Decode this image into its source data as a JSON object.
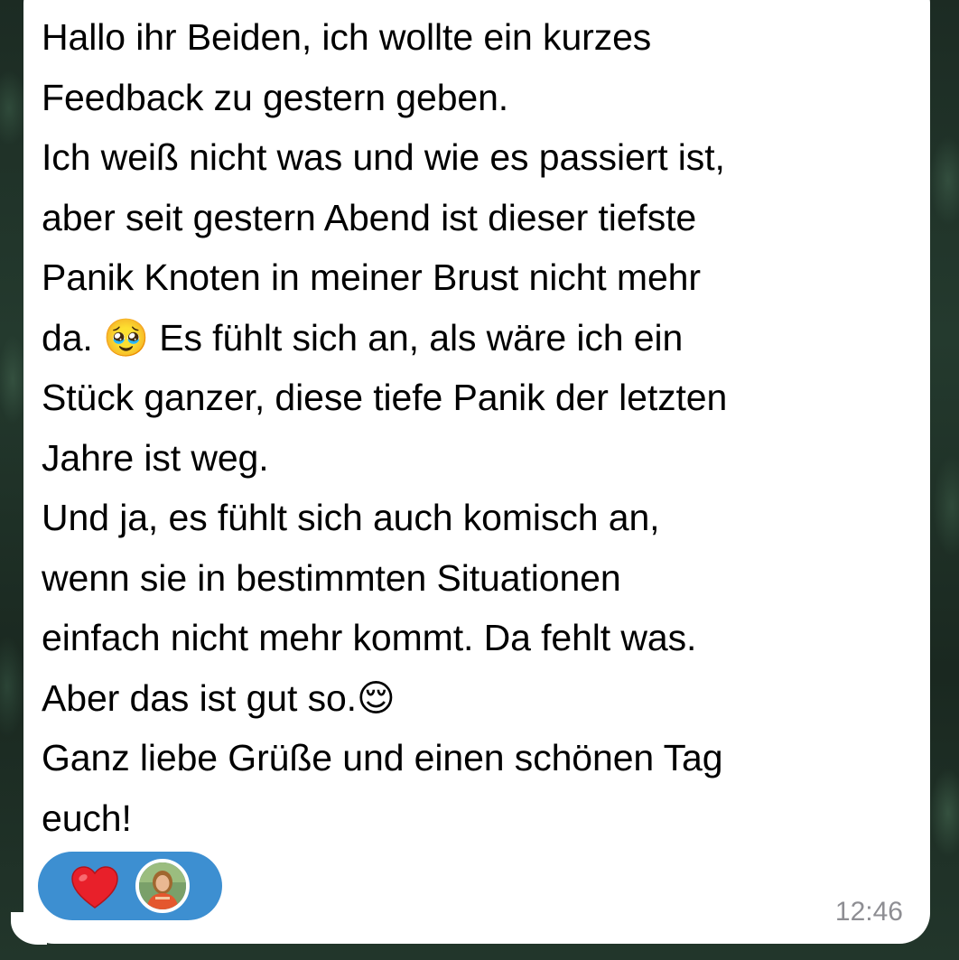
{
  "message": {
    "text": "Hallo ihr Beiden, ich wollte ein kurzes\nFeedback zu gestern geben.\nIch weiß nicht was und wie es passiert ist,\naber seit gestern Abend ist dieser tiefste\nPanik Knoten in meiner Brust nicht mehr\nda. 🥹 Es fühlt sich an, als wäre ich ein\nStück ganzer, diese tiefe Panik der letzten\nJahre ist weg.\nUnd ja, es fühlt sich auch komisch an,\nwenn sie in bestimmten Situationen\neinfach nicht mehr kommt. Da fehlt was.\nAber das ist gut so.😌\nGanz liebe Grüße und einen schönen Tag\neuch!",
    "timestamp": "12:46"
  },
  "reaction": {
    "emoji_icon": "red-heart-icon",
    "reactor_avatar": "user-avatar",
    "pill_color": "#3d8fd1"
  },
  "colors": {
    "bubble": "#ffffff",
    "text": "#000000",
    "timestamp": "#8e8e93",
    "heart": "#e8202a"
  }
}
